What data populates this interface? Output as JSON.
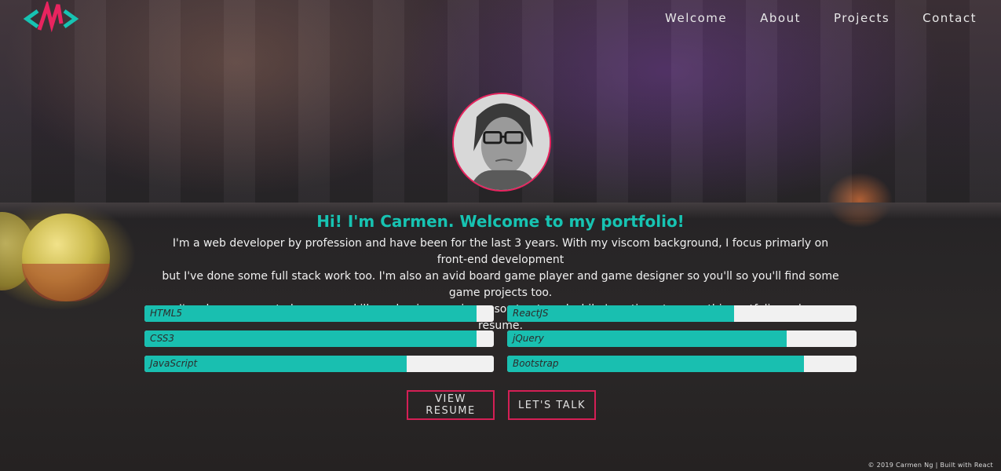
{
  "nav": {
    "items": [
      {
        "label": "Welcome"
      },
      {
        "label": "About"
      },
      {
        "label": "Projects"
      },
      {
        "label": "Contact"
      }
    ]
  },
  "hero": {
    "headline": "Hi! I'm Carmen. Welcome to my portfolio!",
    "intro_lines": [
      "I'm a web developer by profession and have been for the last 3 years. With my viscom background, I focus primarly on front-end development",
      "but I've done some full stack work too. I'm also an avid board game player and game designer so you'll so you'll find some game projects too.",
      "I'm always eager to learn new skills and gain experience so stay tuned while I continue to grow this portfolio and my resume."
    ]
  },
  "skills": [
    {
      "name": "HTML5",
      "level": 0.95
    },
    {
      "name": "ReactJS",
      "level": 0.65
    },
    {
      "name": "CSS3",
      "level": 0.95
    },
    {
      "name": "jQuery",
      "level": 0.8
    },
    {
      "name": "JavaScript",
      "level": 0.75
    },
    {
      "name": "Bootstrap",
      "level": 0.85
    }
  ],
  "buttons": {
    "resume": "VIEW RESUME",
    "talk": "LET'S TALK"
  },
  "footer": {
    "text": "© 2019 Carmen Ng | Built with React"
  },
  "colors": {
    "accent": "#19bfb0",
    "brand_pink": "#e8245f",
    "bar_track": "#f1f1f1"
  },
  "icons": {
    "logo": "nn-logo-icon"
  }
}
